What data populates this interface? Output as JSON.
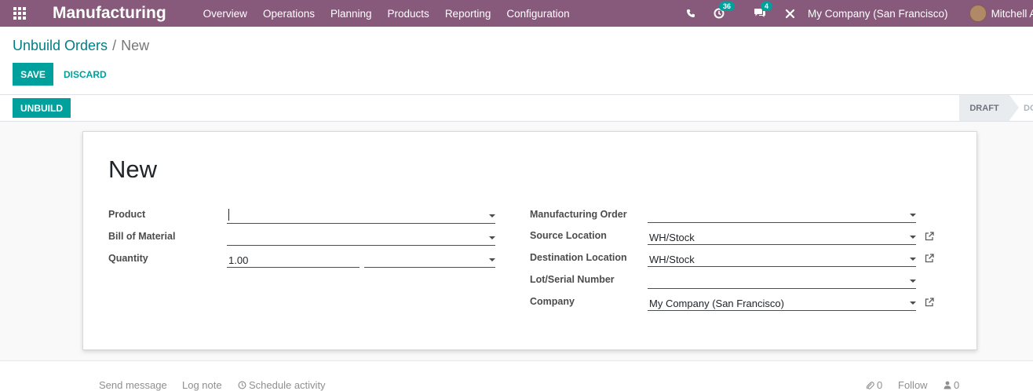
{
  "navbar": {
    "app_title": "Manufacturing",
    "menu": [
      "Overview",
      "Operations",
      "Planning",
      "Products",
      "Reporting",
      "Configuration"
    ],
    "activity_count": "36",
    "message_count": "4",
    "company": "My Company (San Francisco)",
    "user": "Mitchell A"
  },
  "breadcrumb": {
    "parent": "Unbuild Orders",
    "separator": "/",
    "current": "New"
  },
  "buttons": {
    "save": "SAVE",
    "discard": "DISCARD",
    "unbuild": "UNBUILD"
  },
  "statusbar": {
    "stages": [
      "DRAFT",
      "DONE"
    ],
    "active": "DRAFT"
  },
  "form": {
    "title": "New",
    "left": {
      "product_label": "Product",
      "product_value": "",
      "bom_label": "Bill of Material",
      "bom_value": "",
      "quantity_label": "Quantity",
      "quantity_value": "1.00",
      "uom_value": ""
    },
    "right": {
      "mo_label": "Manufacturing Order",
      "mo_value": "",
      "source_label": "Source Location",
      "source_value": "WH/Stock",
      "dest_label": "Destination Location",
      "dest_value": "WH/Stock",
      "lot_label": "Lot/Serial Number",
      "lot_value": "",
      "company_label": "Company",
      "company_value": "My Company (San Francisco)"
    }
  },
  "chatter": {
    "send_message": "Send message",
    "log_note": "Log note",
    "schedule_activity": "Schedule activity",
    "attachments_count": "0",
    "follow": "Follow",
    "followers_count": "0"
  },
  "colors": {
    "navbar": "#875a7b",
    "primary": "#00a09d",
    "link": "#017e84"
  }
}
